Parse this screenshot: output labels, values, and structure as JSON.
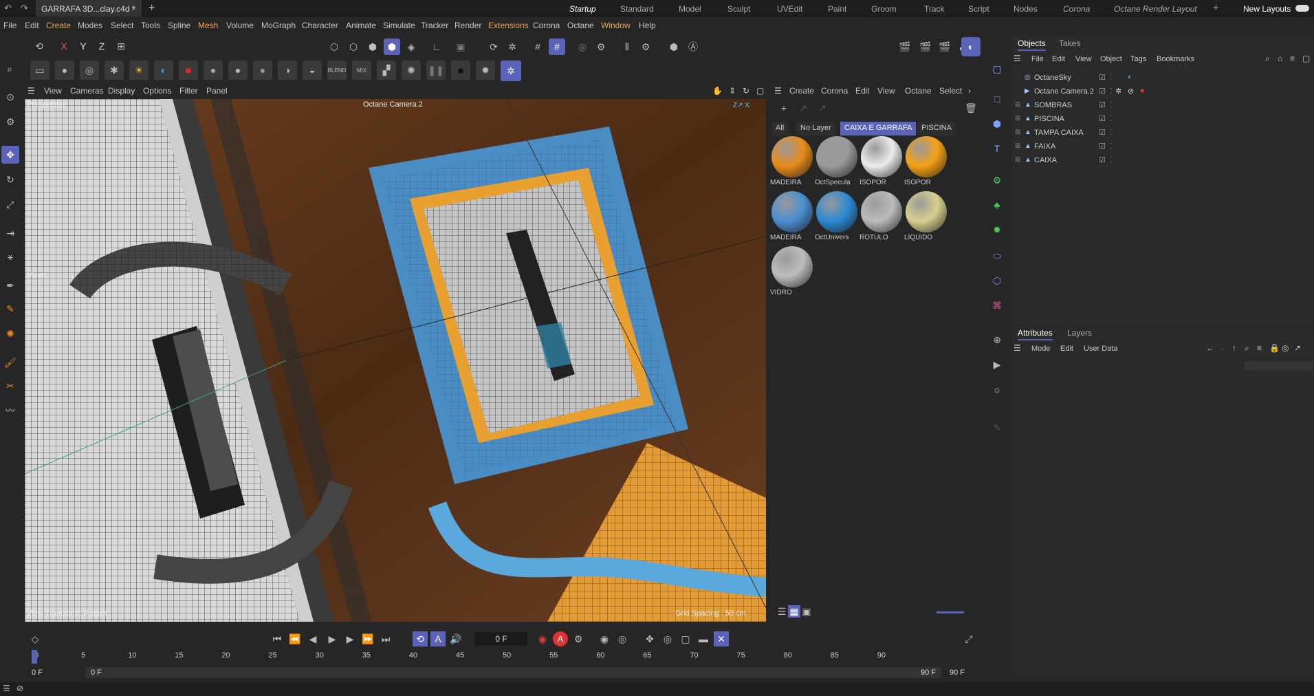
{
  "tab": {
    "title": "GARRAFA 3D...clay.c4d *"
  },
  "layouts": [
    "Startup",
    "Standard",
    "Model",
    "Sculpt",
    "UVEdit",
    "Paint",
    "Groom",
    "Track",
    "Script",
    "Nodes",
    "Corona",
    "Octane Render Layout"
  ],
  "new_layouts": "New Layouts",
  "menus": [
    "File",
    "Edit",
    "Create",
    "Modes",
    "Select",
    "Tools",
    "Spline",
    "Mesh",
    "Volume",
    "MoGraph",
    "Character",
    "Animate",
    "Simulate",
    "Tracker",
    "Render",
    "Extensions",
    "Corona",
    "Octane",
    "Window",
    "Help"
  ],
  "axis_buttons": {
    "x": "X",
    "y": "Y",
    "z": "Z"
  },
  "viewport": {
    "menus": [
      "View",
      "Cameras",
      "Display",
      "Options",
      "Filter",
      "Panel"
    ],
    "mode": "Perspective",
    "camera": "Octane Camera.2",
    "tool": "Move",
    "transform": "View Transform: Project",
    "grid": "Grid Spacing : 50 cm"
  },
  "materials": {
    "menus": [
      "Create",
      "Corona",
      "Edit",
      "View",
      "Octane",
      "Select"
    ],
    "tabs": [
      "All",
      "No Layer",
      "CAIXA E GARRAFA",
      "PISCINA"
    ],
    "items": [
      {
        "label": "MADEIRA",
        "color": "#e88c1c"
      },
      {
        "label": "OctSpecula",
        "color": "#9a9a9a"
      },
      {
        "label": "ISOPOR",
        "color": "#ececec"
      },
      {
        "label": "ISOPOR",
        "color": "#f5a116"
      },
      {
        "label": "MADEIRA",
        "color": "#4a8fd0"
      },
      {
        "label": "OctUnivers",
        "color": "#2e8ad6"
      },
      {
        "label": "RÓTULO",
        "color": "#bcbcbc"
      },
      {
        "label": "LÍQUIDO",
        "color": "#d8cf8e"
      },
      {
        "label": "VIDRO",
        "color": "#bdbdbd"
      }
    ]
  },
  "objects": {
    "tabs": [
      "Objects",
      "Takes"
    ],
    "menus": [
      "File",
      "Edit",
      "View",
      "Object",
      "Tags",
      "Bookmarks"
    ],
    "items": [
      "OctaneSky",
      "Octane Camera.2",
      "SOMBRAS",
      "PISCINA",
      "TAMPA CAIXA",
      "FAIXA",
      "CAIXA"
    ]
  },
  "attributes": {
    "tabs": [
      "Attributes",
      "Layers"
    ],
    "menus": [
      "Mode",
      "Edit",
      "User Data"
    ]
  },
  "timeline": {
    "frame": "0 F",
    "ticks": [
      "0",
      "5",
      "10",
      "15",
      "20",
      "25",
      "30",
      "35",
      "40",
      "45",
      "50",
      "55",
      "60",
      "65",
      "70",
      "75",
      "80",
      "85",
      "90"
    ],
    "start": "0 F",
    "start2": "0 F",
    "end": "90 F",
    "end2": "90 F"
  }
}
